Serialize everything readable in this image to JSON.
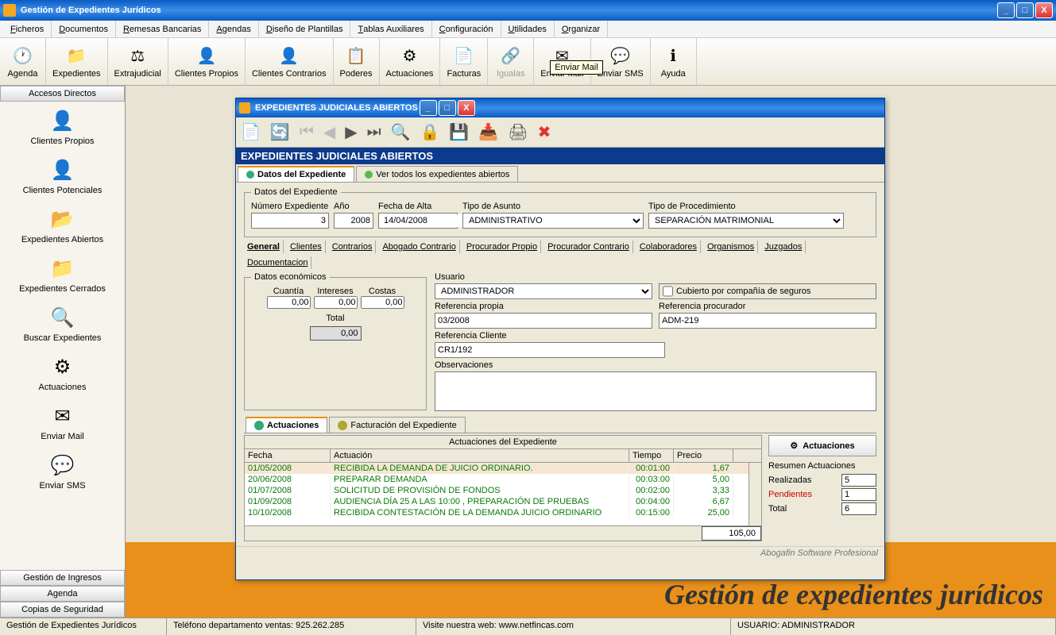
{
  "app_title": "Gestión de Expedientes Jurídicos",
  "menu": [
    "Ficheros",
    "Documentos",
    "Remesas Bancarias",
    "Agendas",
    "Diseño de Plantillas",
    "Tablas Auxiliares",
    "Configuración",
    "Utilidades",
    "Organizar"
  ],
  "toolbar": [
    {
      "label": "Agenda"
    },
    {
      "label": "Expedientes"
    },
    {
      "label": "Extrajudicial"
    },
    {
      "label": "Clientes Propios"
    },
    {
      "label": "Clientes Contrarios"
    },
    {
      "label": "Poderes"
    },
    {
      "label": "Actuaciones"
    },
    {
      "label": "Facturas"
    },
    {
      "label": "Igualas",
      "disabled": true
    },
    {
      "label": "Enviar Mail",
      "tooltip": "Enviar Mail"
    },
    {
      "label": "Enviar SMS"
    },
    {
      "label": "Ayuda"
    }
  ],
  "sidebar": {
    "header": "Accesos Directos",
    "items": [
      "Clientes Propios",
      "Clientes Potenciales",
      "Expedientes Abiertos",
      "Expedientes Cerrados",
      "Buscar Expedientes",
      "Actuaciones",
      "Enviar Mail",
      "Enviar SMS"
    ],
    "footer": [
      "Gestión de Ingresos",
      "Agenda",
      "Copias de Seguridad"
    ]
  },
  "banner": "Gestión de expedientes jurídicos",
  "child": {
    "title": "EXPEDIENTES JUDICIALES ABIERTOS",
    "header": "EXPEDIENTES JUDICIALES ABIERTOS",
    "tabs": [
      "Datos del Expediente",
      "Ver todos los expedientes abiertos"
    ],
    "fieldset1": "Datos del Expediente",
    "f": {
      "num_lbl": "Número Expediente",
      "num": "3",
      "ano_lbl": "Año",
      "ano": "2008",
      "falta_lbl": "Fecha de Alta",
      "falta": "14/04/2008",
      "tipo_asunto_lbl": "Tipo de Asunto",
      "tipo_asunto": "ADMINISTRATIVO",
      "tipo_proc_lbl": "Tipo de Procedimiento",
      "tipo_proc": "SEPARACIÓN MATRIMONIAL"
    },
    "subtabs": [
      "General",
      "Clientes",
      "Contrarios",
      "Abogado Contrario",
      "Procurador Propio",
      "Procurador Contrario",
      "Colaboradores",
      "Organismos",
      "Juzgados",
      "Documentacion"
    ],
    "econ": {
      "legend": "Datos económicos",
      "cuantia_lbl": "Cuantía",
      "cuantia": "0,00",
      "intereses_lbl": "Intereses",
      "intereses": "0,00",
      "costas_lbl": "Costas",
      "costas": "0,00",
      "total_lbl": "Total",
      "total": "0,00"
    },
    "right": {
      "usuario_lbl": "Usuario",
      "usuario": "ADMINISTRADOR",
      "seguro_lbl": "Cubierto por compañía de seguros",
      "refp_lbl": "Referencia propia",
      "refp": "03/2008",
      "refpr_lbl": "Referencia procurador",
      "refpr": "ADM-219",
      "refc_lbl": "Referencia Cliente",
      "refc": "CR1/192",
      "obs_lbl": "Observaciones"
    },
    "tabs2": [
      "Actuaciones",
      "Facturación del Expediente"
    ],
    "grid": {
      "title": "Actuaciones del Expediente",
      "cols": [
        "Fecha",
        "Actuación",
        "Tiempo",
        "Precio"
      ],
      "rows": [
        {
          "f": "01/05/2008",
          "a": "RECIBIDA LA DEMANDA DE JUICIO ORDINARIO.",
          "t": "00:01:00",
          "p": "1,67",
          "sel": true
        },
        {
          "f": "20/06/2008",
          "a": "PREPARAR DEMANDA",
          "t": "00:03:00",
          "p": "5,00"
        },
        {
          "f": "01/07/2008",
          "a": "SOLICITUD DE PROVISIÓN DE FONDOS",
          "t": "00:02:00",
          "p": "3,33"
        },
        {
          "f": "01/09/2008",
          "a": "AUDIENCIA DÍA 25 A LAS 10:00 , PREPARACIÓN DE PRUEBAS",
          "t": "00:04:00",
          "p": "6,67"
        },
        {
          "f": "10/10/2008",
          "a": "RECIBIDA CONTESTACIÓN DE LA DEMANDA JUICIO ORDINARIO",
          "t": "00:15:00",
          "p": "25,00"
        }
      ],
      "total": "105,00"
    },
    "act": {
      "btn": "Actuaciones",
      "title": "Resumen Actuaciones",
      "realizadas_lbl": "Realizadas",
      "realizadas": "5",
      "pendientes_lbl": "Pendientes",
      "pendientes": "1",
      "total_lbl": "Total",
      "total": "6"
    },
    "footer": "Abogafin Software Profesional"
  },
  "status": {
    "s1": "Gestión de Expedientes Jurídicos",
    "s2": "Teléfono departamento ventas: 925.262.285",
    "s3": "Visite nuestra web: www.netfincas.com",
    "s4": "USUARIO: ADMINISTRADOR"
  }
}
